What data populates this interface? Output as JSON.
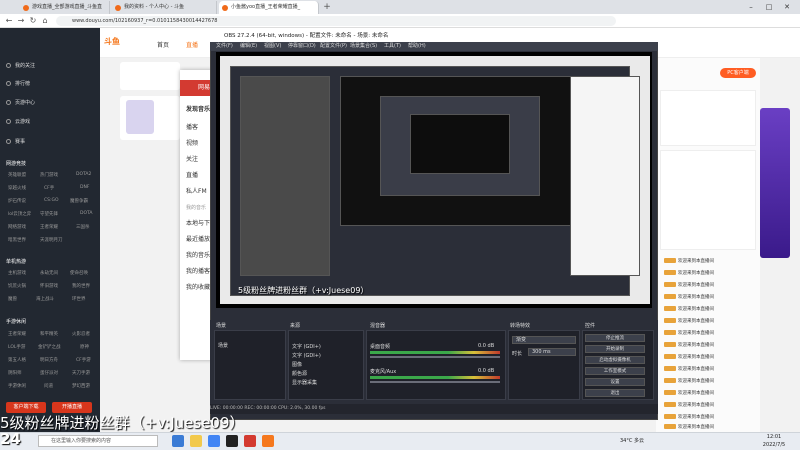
{
  "browser": {
    "tabs": [
      {
        "label": "游戏直播_全部游戏直播_斗鱼直"
      },
      {
        "label": "我的资料 - 个人中心 - 斗鱼"
      },
      {
        "label": "小鱼酱yoo直播_王者荣耀直播_"
      }
    ],
    "url": "www.douyu.com/102160937_r=0.0101158430014427678"
  },
  "douyu": {
    "nav": {
      "home": "首页",
      "live": "直播"
    },
    "sidebar": {
      "items": [
        "我的关注",
        "排行榜",
        "页游中心",
        "云游戏",
        "赛事"
      ],
      "section_hot": "网游竞技",
      "hot_games": [
        "英雄联盟",
        "热门游戏",
        "DOTA2",
        "穿越火线",
        "CF手",
        "DNF",
        "炉石传说",
        "CS:GO",
        "魔兽争霸",
        "lol云顶之弈",
        "守望先锋",
        "DOTA",
        "网络游戏",
        "王者荣耀",
        "三国杀",
        "暗黑世界",
        "天涯明月刀"
      ],
      "section_mobile": "单机热游",
      "mobile_games": [
        "主机游戏",
        "永劫无间",
        "使命召唤",
        "饥荒火锅",
        "怀旧游戏",
        "我的世界",
        "魔兽",
        "海上战斗",
        "环世界",
        "单机游戏"
      ],
      "section_hand": "手游休闲",
      "hand_games": [
        "王者荣耀",
        "和平精英",
        "火影忍者",
        "LOL手游",
        "金铲铲之战",
        "原神",
        "第五人格",
        "明日方舟",
        "CF手游",
        "阴阳师",
        "蛋仔派对",
        "天刀手游",
        "手游休闲",
        "问道",
        "梦幻西游"
      ],
      "btn_download": "客户端下载",
      "btn_open": "开播直播"
    },
    "pc_button": "PC客户端",
    "chat": [
      "欢迎来到本直播间",
      "欢迎来到本直播间",
      "欢迎来到本直播间",
      "欢迎来到本直播间",
      "欢迎来到本直播间",
      "欢迎来到本直播间",
      "欢迎来到本直播间",
      "欢迎来到本直播间",
      "欢迎来到本直播间",
      "欢迎来到本直播间",
      "欢迎来到本直播间",
      "欢迎来到本直播间",
      "欢迎来到本直播间",
      "欢迎来到本直播间",
      "欢迎来到本直播间"
    ]
  },
  "music": {
    "title": "网易",
    "items": [
      "发现音乐",
      "播客",
      "视频",
      "关注",
      "直播",
      "私人FM",
      "我的音乐",
      "本地与下载",
      "最近播放",
      "我的音乐云盘",
      "我的播客",
      "我的收藏"
    ]
  },
  "obs": {
    "title": "OBS 27.2.4 (64-bit, windows) - 配置文件: 未命名 - 场景: 未命名",
    "menu": [
      "文件(F)",
      "编辑(E)",
      "视图(V)",
      "停靠窗口(D)",
      "配置文件(P)",
      "场景集合(S)",
      "工具(T)",
      "帮助(H)"
    ],
    "docks": {
      "scenes": "场景",
      "sources": "来源",
      "mixer": "混音器",
      "transitions": "转场特效",
      "controls": "控件"
    },
    "scene_name": "场景",
    "sources": [
      "文字 (GDI+)",
      "文字 (GDI+)",
      "图像",
      "颜色源",
      "显示器采集"
    ],
    "mixer": [
      {
        "name": "桌面音频",
        "db": "0.0 dB"
      },
      {
        "name": "麦克风/Aux",
        "db": "0.0 dB"
      }
    ],
    "transition": {
      "type": "渐变",
      "duration_label": "时长",
      "duration": "300 ms"
    },
    "controls": [
      "停止推流",
      "开始录制",
      "启动虚拟摄像机",
      "工作室模式",
      "设置",
      "退出"
    ],
    "status": "LIVE: 00:00:00   REC: 00:00:00   CPU: 2.0%, 30.00 fps"
  },
  "overlay": {
    "fan_text": "5级粉丝牌进粉丝群（+v:Juese09）",
    "fan_text_small": "5级粉丝牌进粉丝群（+v:Juese09）",
    "live_number": "24"
  },
  "taskbar": {
    "search_placeholder": "在这里输入你要搜索的内容",
    "weather": "34°C 多云",
    "time": "12:01",
    "date": "2022/7/5"
  },
  "colors": {
    "douyu_orange": "#f5781e",
    "obs_bg": "#2b2e38",
    "music_red": "#d33a31"
  }
}
